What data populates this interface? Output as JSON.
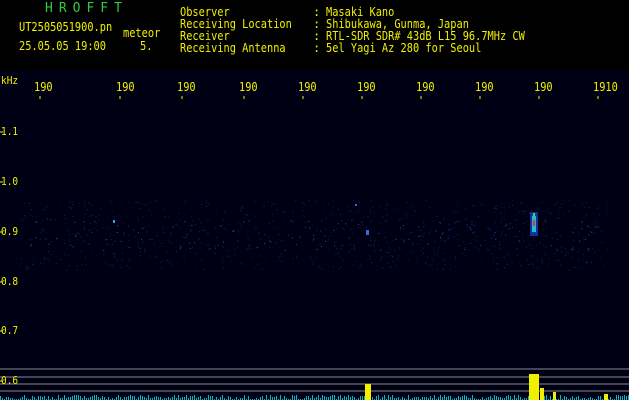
{
  "header": {
    "app_title": "HROFFT",
    "file_name": "UT2505051900.pn",
    "mode": "meteor",
    "date_time": "25.05.05 19:00",
    "count": "5.",
    "info": [
      {
        "label": "Observer",
        "value": "Masaki Kano"
      },
      {
        "label": "Receiving Location",
        "value": "Shibukawa, Gunma, Japan"
      },
      {
        "label": "Receiver",
        "value": "RTL-SDR SDR# 43dB L15 96.7MHz CW"
      },
      {
        "label": "Receiving Antenna",
        "value": "5el Yagi Az 280 for Seoul"
      }
    ]
  },
  "axes": {
    "y_unit": "kHz",
    "x_ticks": [
      "190",
      "190",
      "190",
      "190",
      "190",
      "190",
      "190",
      "190",
      "190",
      "1910"
    ],
    "y_ticks": [
      "1.1",
      "1.0",
      "0.9",
      "0.8",
      "0.7",
      "0.6"
    ]
  },
  "colors": {
    "text": "#f0f000",
    "title": "#2ecc40",
    "background": "#000014"
  }
}
